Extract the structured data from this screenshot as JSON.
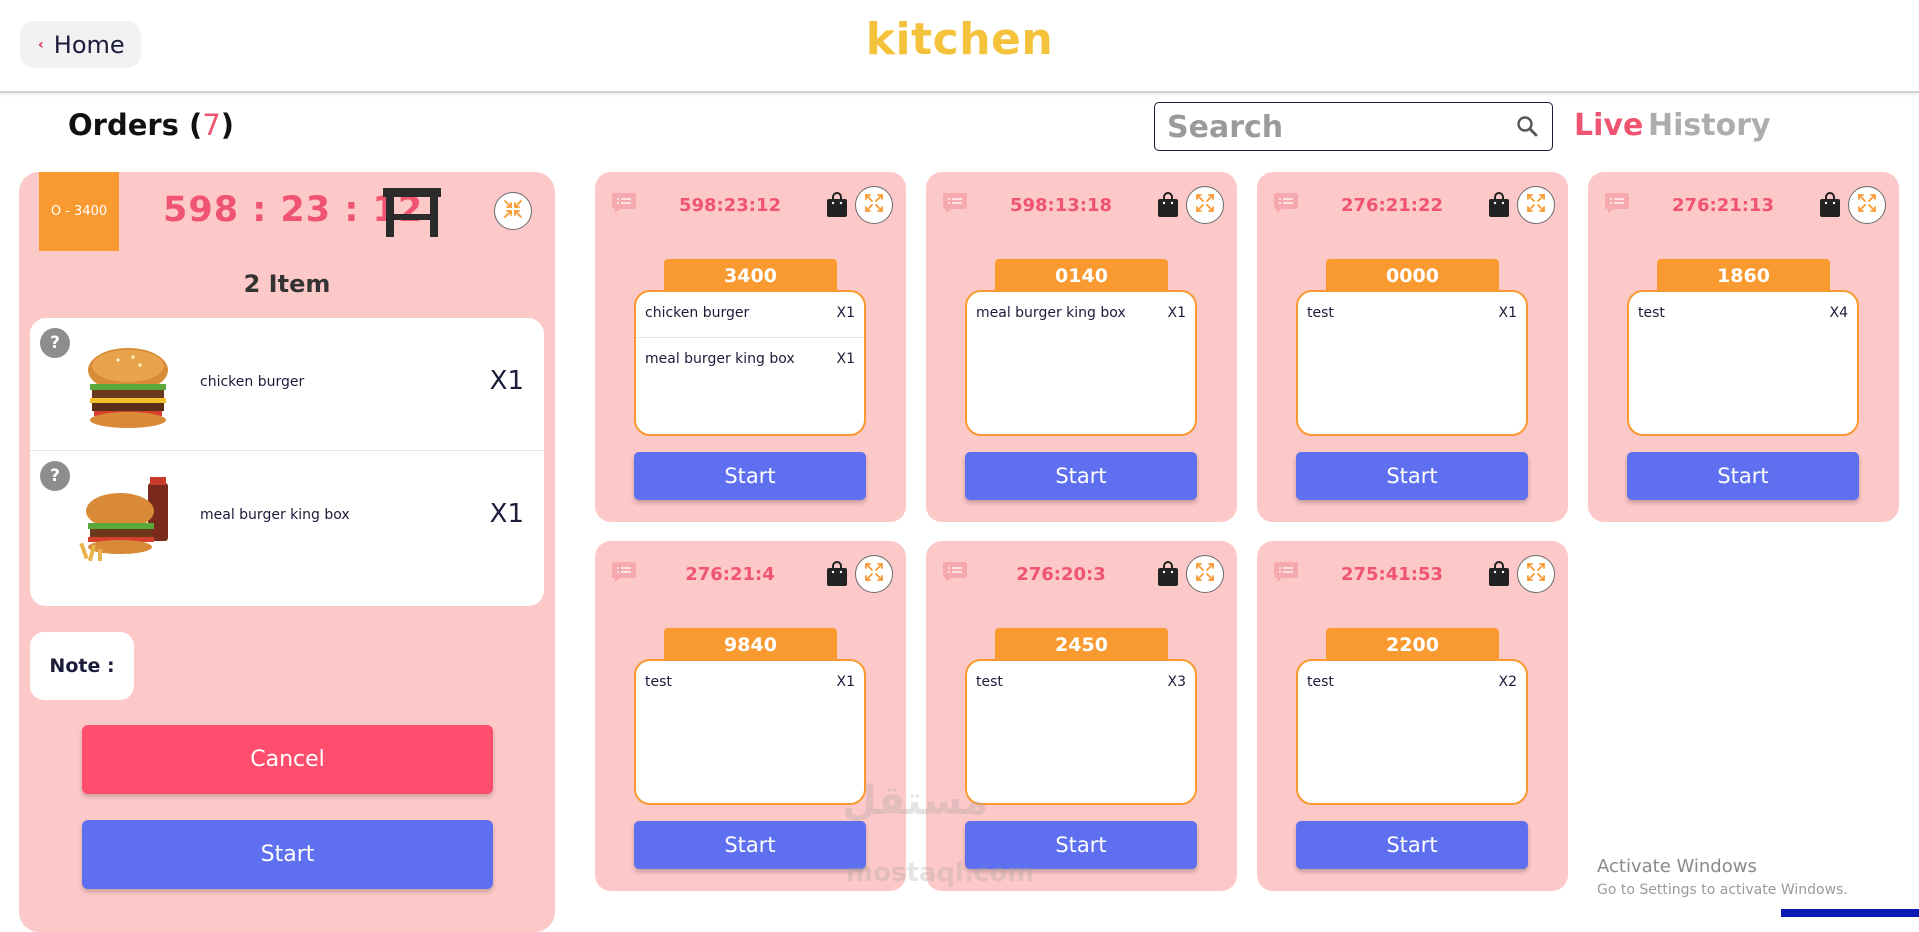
{
  "header": {
    "home_label": "Home",
    "title": "kitchen"
  },
  "orders": {
    "label": "Orders",
    "count_open": " (",
    "count": "7",
    "count_close": ")"
  },
  "search": {
    "placeholder": "Search"
  },
  "tabs": {
    "live": "Live",
    "history": "History"
  },
  "detail": {
    "order_tag": "O - 3400",
    "timer": "598 : 23 : 12",
    "item_count": "2 Item",
    "items": [
      {
        "name": "chicken burger",
        "qty": "X1",
        "help": "?"
      },
      {
        "name": "meal burger king box",
        "qty": "X1",
        "help": "?"
      }
    ],
    "note_label": "Note :",
    "cancel_label": "Cancel",
    "start_label": "Start"
  },
  "cards": [
    {
      "timer": "598:23:12",
      "code": "3400",
      "items": [
        {
          "name": "chicken burger",
          "qty": "X1"
        },
        {
          "name": "meal burger king box",
          "qty": "X1"
        }
      ],
      "start": "Start"
    },
    {
      "timer": "598:13:18",
      "code": "0140",
      "items": [
        {
          "name": "meal burger king box",
          "qty": "X1"
        }
      ],
      "start": "Start"
    },
    {
      "timer": "276:21:22",
      "code": "0000",
      "items": [
        {
          "name": "test",
          "qty": "X1"
        }
      ],
      "start": "Start"
    },
    {
      "timer": "276:21:13",
      "code": "1860",
      "items": [
        {
          "name": "test",
          "qty": "X4"
        }
      ],
      "start": "Start"
    },
    {
      "timer": "276:21:4",
      "code": "9840",
      "items": [
        {
          "name": "test",
          "qty": "X1"
        }
      ],
      "start": "Start"
    },
    {
      "timer": "276:20:3",
      "code": "2450",
      "items": [
        {
          "name": "test",
          "qty": "X3"
        }
      ],
      "start": "Start"
    },
    {
      "timer": "275:41:53",
      "code": "2200",
      "items": [
        {
          "name": "test",
          "qty": "X2"
        }
      ],
      "start": "Start"
    }
  ],
  "icons": {
    "home_back": "chevron-left-icon",
    "search": "search-icon",
    "table": "table-icon",
    "collapse": "collapse-icon",
    "expand": "expand-icon",
    "message": "message-icon",
    "bag": "bag-icon"
  },
  "colors": {
    "brand_yellow": "#f5c33b",
    "accent_pink": "#ef5470",
    "card_bg": "#fdc8c8",
    "orange": "#f99a31",
    "start_blue": "#5e6ff0",
    "cancel_red": "#ff4d6e"
  },
  "watermark": {
    "arabic": "مستقل",
    "latin": "mostaql.com"
  },
  "os_notice": {
    "line1": "Activate Windows",
    "line2": "Go to Settings to activate Windows."
  }
}
